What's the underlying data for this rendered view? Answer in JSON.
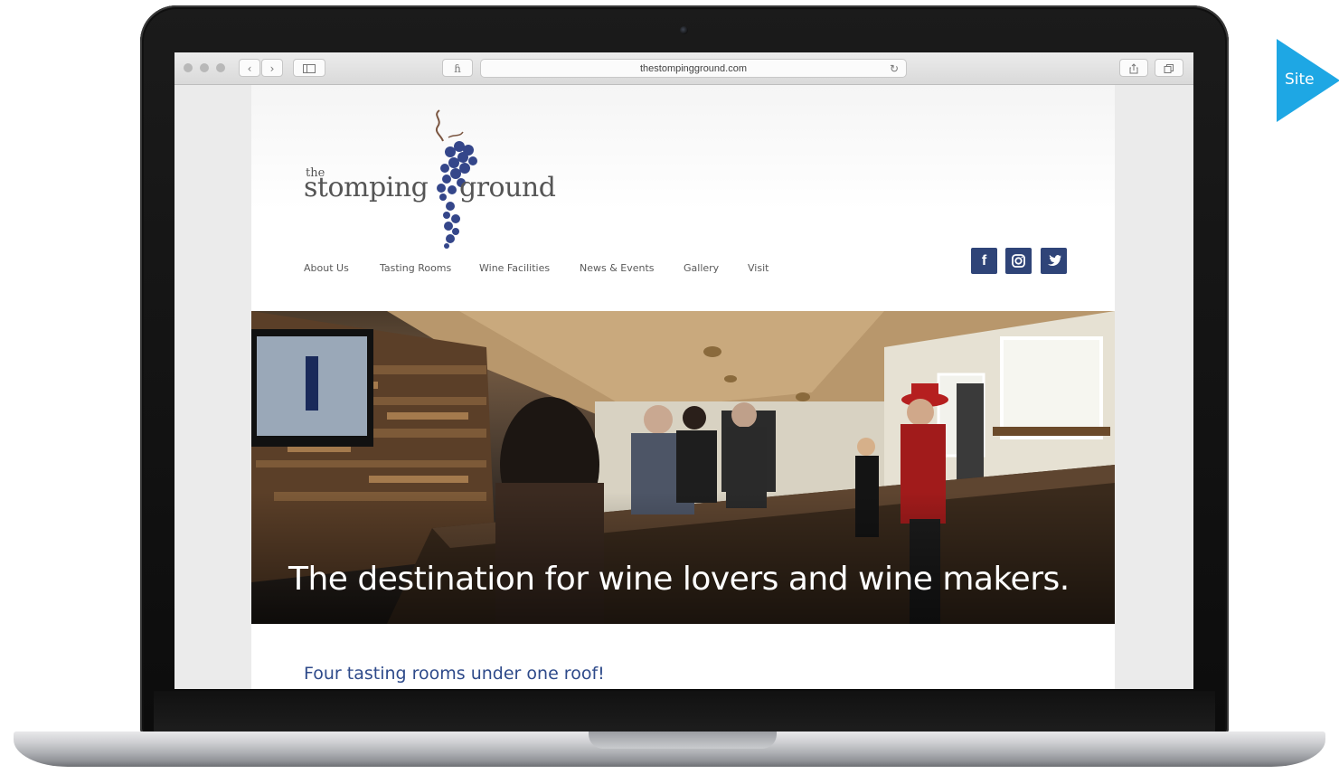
{
  "browser": {
    "url": "thestompingground.com",
    "reader_icon": "reader-icon",
    "reload_icon": "reload-icon",
    "share_icon": "share-icon",
    "tabs_icon": "tabs-icon"
  },
  "site": {
    "logo": {
      "the": "the",
      "word1": "stomping",
      "word2": "ground"
    },
    "nav": [
      "About Us",
      "Tasting Rooms",
      "Wine Facilities",
      "News & Events",
      "Gallery",
      "Visit"
    ],
    "social": [
      {
        "name": "facebook-icon",
        "glyph": "f"
      },
      {
        "name": "instagram-icon",
        "glyph": "◎"
      },
      {
        "name": "twitter-icon",
        "glyph": "🐦"
      }
    ],
    "hero_caption": "The destination for wine lovers and wine makers.",
    "subheading": "Four tasting rooms under one roof!"
  },
  "badge": {
    "label": "Site",
    "color": "#1ea7e4"
  },
  "colors": {
    "brand_blue": "#2f4478",
    "heading_blue": "#2e4a8a"
  }
}
